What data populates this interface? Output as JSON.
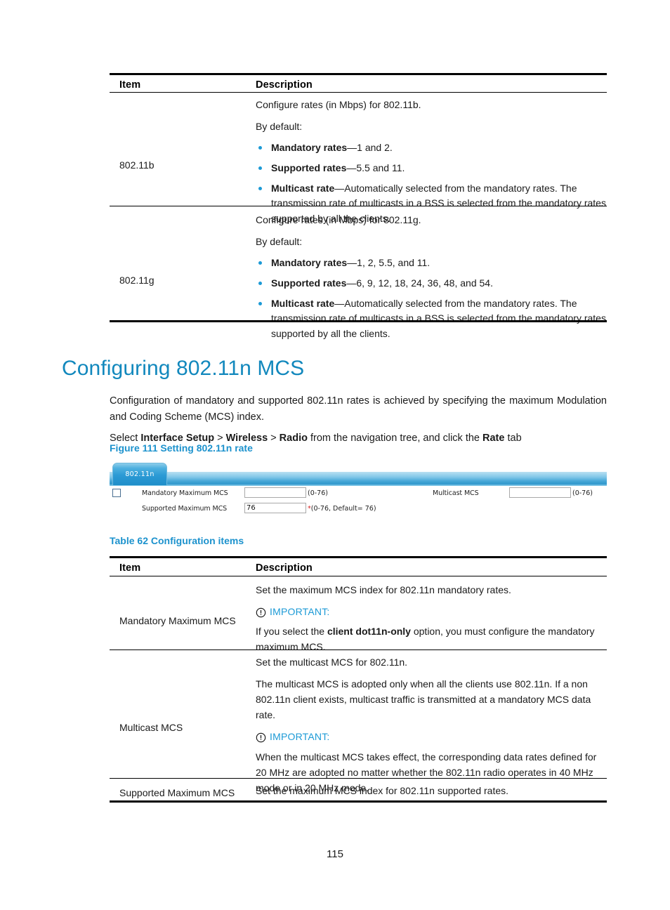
{
  "document": {
    "page_number": "115"
  },
  "table_top": {
    "headers": {
      "item": "Item",
      "description": "Description"
    },
    "rows": [
      {
        "item": "802.11b",
        "intro": "Configure rates (in Mbps) for 802.11b.",
        "default_label": "By default:",
        "bullets": [
          {
            "term": "Mandatory rates",
            "rest": "—1 and 2."
          },
          {
            "term": "Supported rates",
            "rest": "—5.5 and 11."
          },
          {
            "term": "Multicast rate",
            "rest": "—Automatically selected from the mandatory rates. The transmission rate of multicasts in a BSS is selected from the mandatory rates supported by all the clients."
          }
        ]
      },
      {
        "item": "802.11g",
        "intro": "Configure rates (in Mbps) for 802.11g.",
        "default_label": "By default:",
        "bullets": [
          {
            "term": "Mandatory rates",
            "rest": "—1, 2, 5.5, and 11."
          },
          {
            "term": "Supported rates",
            "rest": "—6, 9, 12, 18, 24, 36, 48, and 54."
          },
          {
            "term": "Multicast rate",
            "rest": "—Automatically selected from the mandatory rates. The transmission rate of multicasts in a BSS is selected from the mandatory rates supported by all the clients."
          }
        ]
      }
    ]
  },
  "section": {
    "heading": "Configuring 802.11n MCS",
    "paragraph": "Configuration of mandatory and supported 802.11n rates is achieved by specifying the maximum Modulation and Coding Scheme (MCS) index.",
    "navigation": {
      "prefix": "Select ",
      "path_1": "Interface Setup",
      "sep_1": " > ",
      "path_2": "Wireless",
      "sep_2": " > ",
      "path_3": "Radio",
      "middle": " from the navigation tree, and click the ",
      "path_4": "Rate",
      "suffix": " tab"
    },
    "figure_caption": "Figure 111 Setting 802.11n rate"
  },
  "figure": {
    "tab_label": "802.11n",
    "fields": {
      "mandatory": {
        "label": "Mandatory Maximum MCS",
        "value": "",
        "hint": "(0-76)"
      },
      "supported": {
        "label": "Supported Maximum MCS",
        "value": "76",
        "required_marker": "*",
        "hint": "(0-76, Default= 76)"
      },
      "multicast": {
        "label": "Multicast MCS",
        "value": "",
        "hint": "(0-76)"
      }
    }
  },
  "table_62": {
    "caption": "Table 62 Configuration items",
    "headers": {
      "item": "Item",
      "description": "Description"
    },
    "rows": [
      {
        "item": "Mandatory Maximum MCS",
        "lead": "Set the maximum MCS index for 802.11n mandatory rates.",
        "important_label": "IMPORTANT:",
        "note_pre": "If you select the ",
        "note_bold": "client dot11n-only",
        "note_post": " option, you must configure the mandatory maximum MCS."
      },
      {
        "item": "Multicast MCS",
        "lead": "Set the multicast MCS for 802.11n.",
        "body": "The multicast MCS is adopted only when all the clients use 802.11n. If a non 802.11n client exists, multicast traffic is transmitted at a mandatory MCS data rate.",
        "important_label": "IMPORTANT:",
        "note": "When the multicast MCS takes effect, the corresponding data rates defined for 20 MHz are adopted no matter whether the 802.11n radio operates in 40 MHz mode or in 20 MHz mode."
      },
      {
        "item": "Supported Maximum MCS",
        "lead": "Set the maximum MCS index for 802.11n supported rates."
      }
    ]
  },
  "colors": {
    "heading_blue": "#1288bd",
    "caption_blue": "#1c92cd",
    "bullet_blue": "#1c9ad6",
    "important_blue": "#1c9ad6",
    "required_red": "#d81f1f"
  }
}
